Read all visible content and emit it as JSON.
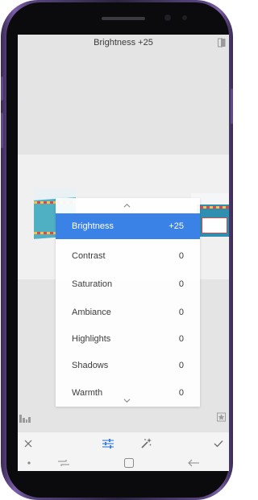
{
  "header": {
    "title": "Brightness +25",
    "compare_icon": "compare-icon"
  },
  "tune_panel": {
    "up_icon": "chevron-up-icon",
    "down_icon": "chevron-down-icon",
    "items": [
      {
        "label": "Brightness",
        "value": "+25",
        "selected": true
      },
      {
        "label": "Contrast",
        "value": "0",
        "selected": false
      },
      {
        "label": "Saturation",
        "value": "0",
        "selected": false
      },
      {
        "label": "Ambiance",
        "value": "0",
        "selected": false
      },
      {
        "label": "Highlights",
        "value": "0",
        "selected": false
      },
      {
        "label": "Shadows",
        "value": "0",
        "selected": false
      },
      {
        "label": "Warmth",
        "value": "0",
        "selected": false
      }
    ]
  },
  "toolbar": {
    "histogram_icon": "histogram-icon",
    "bookmark_icon": "bookmark-icon",
    "cancel_icon": "close-icon",
    "adjust_icon": "sliders-icon",
    "auto_icon": "magic-wand-icon",
    "apply_icon": "checkmark-icon"
  },
  "navigation": {
    "dot_icon": "dot-icon",
    "recents_icon": "recents-icon",
    "home_icon": "home-icon",
    "back_icon": "back-arrow-icon"
  },
  "colors": {
    "accent": "#3b82e6",
    "phone_frame": "#5d4a86"
  }
}
